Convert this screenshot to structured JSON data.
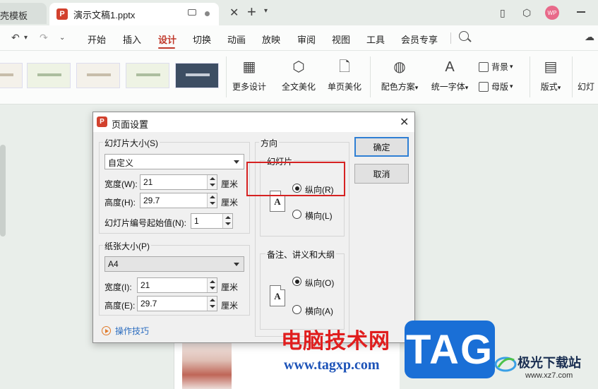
{
  "tabs": {
    "prev_tab": "壳模板",
    "active_tab": "演示文稿1.pptx",
    "ppt_badge": "P"
  },
  "user": {
    "avatar": "WP"
  },
  "menu": {
    "items": [
      "开始",
      "插入",
      "设计",
      "切换",
      "动画",
      "放映",
      "审阅",
      "视图",
      "工具",
      "会员专享"
    ],
    "active": "设计"
  },
  "ribbon": {
    "more_design": "更多设计",
    "full_beautify": "全文美化",
    "single_beautify": "单页美化",
    "color_scheme": "配色方案",
    "unify_font": "统一字体",
    "background": "背景",
    "master": "母版",
    "layout": "版式",
    "partial": "幻灯"
  },
  "dialog": {
    "title": "页面设置",
    "slide_size": {
      "legend": "幻灯片大小(S)",
      "preset": "自定义",
      "width_label": "宽度(W):",
      "width_value": "21",
      "height_label": "高度(H):",
      "height_value": "29.7",
      "unit": "厘米",
      "start_label": "幻灯片编号起始值(N):",
      "start_value": "1"
    },
    "paper_size": {
      "legend": "纸张大小(P)",
      "preset": "A4",
      "width_label": "宽度(I):",
      "width_value": "21",
      "height_label": "高度(E):",
      "height_value": "29.7",
      "unit": "厘米"
    },
    "orientation": {
      "legend": "方向",
      "slides_legend": "幻灯片",
      "slides_portrait": "纵向(R)",
      "slides_landscape": "横向(L)",
      "notes_legend": "备注、讲义和大纲",
      "notes_portrait": "纵向(O)",
      "notes_landscape": "横向(A)",
      "page_glyph": "A"
    },
    "ok": "确定",
    "cancel": "取消",
    "tips": "操作技巧"
  },
  "watermarks": {
    "site_cn": "电脑技术网",
    "site_url": "www.tagxp.com",
    "tag": "TAG",
    "jg_name": "极光下载站",
    "jg_url": "www.xz7.com"
  }
}
